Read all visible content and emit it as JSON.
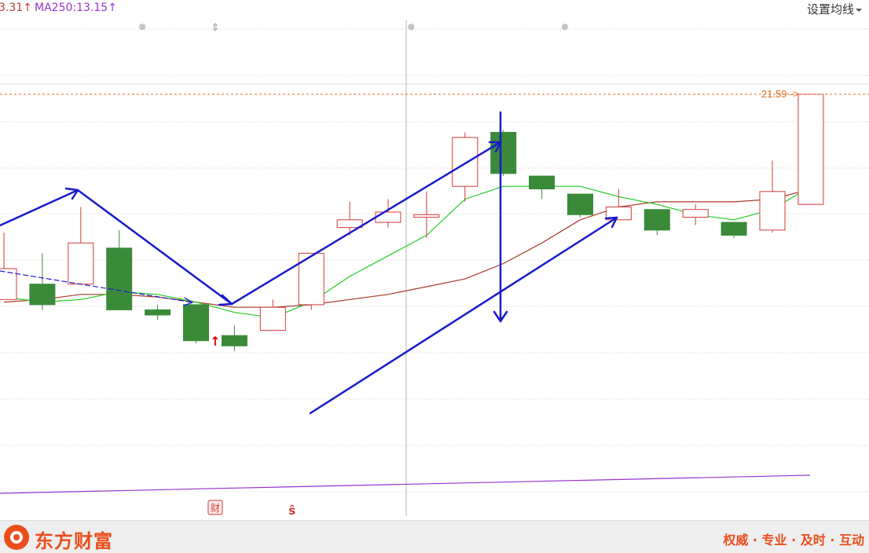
{
  "legend": {
    "ma_prev_text": "3.31",
    "ma250_label": "MA250:13.15",
    "arrow_glyph": "↑",
    "ma_prev_color": "#b0403a",
    "ma250_color": "#9933cc"
  },
  "header": {
    "settings_label": "设置均线",
    "settings_icon": "caret-down-icon"
  },
  "price_label": {
    "value": "21.59",
    "arrow": "->",
    "color": "#e07020"
  },
  "markers": {
    "star_glyph": "✵",
    "double_glyph": "⇕",
    "up_arrow_glyph": "↑",
    "fin_badge": "财",
    "s_badge": "S",
    "s_glyph": "ŝ"
  },
  "footer": {
    "brand": "东方财富",
    "slogan": "权威 · 专业 · 及时 · 互动",
    "brand_color": "#e94e1b"
  },
  "chart_data": {
    "type": "candlestick",
    "y_axis_visible": false,
    "y_scale_note": "price levels are read from the single printed reference price 21.59",
    "reference_price": 21.59,
    "candles": [
      {
        "open": 17.6,
        "close": 18.2,
        "high": 18.9,
        "low": 17.6
      },
      {
        "open": 17.9,
        "close": 17.5,
        "high": 18.5,
        "low": 17.4
      },
      {
        "open": 17.9,
        "close": 18.7,
        "high": 19.4,
        "low": 17.9
      },
      {
        "open": 18.6,
        "close": 17.4,
        "high": 18.95,
        "low": 17.4
      },
      {
        "open": 17.4,
        "close": 17.3,
        "high": 17.5,
        "low": 17.2
      },
      {
        "open": 17.5,
        "close": 16.8,
        "high": 17.5,
        "low": 16.75
      },
      {
        "open": 16.9,
        "close": 16.7,
        "high": 17.1,
        "low": 16.6
      },
      {
        "open": 17.0,
        "close": 17.45,
        "high": 17.6,
        "low": 17.0
      },
      {
        "open": 17.5,
        "close": 18.5,
        "high": 18.5,
        "low": 17.4
      },
      {
        "open": 19.0,
        "close": 19.15,
        "high": 19.5,
        "low": 18.85
      },
      {
        "open": 19.1,
        "close": 19.3,
        "high": 19.55,
        "low": 19.0
      },
      {
        "open": 19.2,
        "close": 19.25,
        "high": 19.7,
        "low": 18.8
      },
      {
        "open": 19.8,
        "close": 20.75,
        "high": 20.85,
        "low": 19.5
      },
      {
        "open": 20.85,
        "close": 20.05,
        "high": 20.9,
        "low": 20.0
      },
      {
        "open": 20.0,
        "close": 19.75,
        "high": 20.0,
        "low": 19.55
      },
      {
        "open": 19.65,
        "close": 19.25,
        "high": 19.65,
        "low": 19.2
      },
      {
        "open": 19.15,
        "close": 19.4,
        "high": 19.75,
        "low": 19.15
      },
      {
        "open": 19.35,
        "close": 18.95,
        "high": 19.35,
        "low": 18.85
      },
      {
        "open": 19.2,
        "close": 19.35,
        "high": 19.45,
        "low": 19.05
      },
      {
        "open": 19.1,
        "close": 18.85,
        "high": 19.1,
        "low": 18.8
      },
      {
        "open": 18.95,
        "close": 19.7,
        "high": 20.3,
        "low": 18.9
      },
      {
        "open": 19.45,
        "close": 21.59,
        "high": 21.59,
        "low": 19.45
      }
    ],
    "ma_short": [
      17.65,
      17.55,
      17.6,
      17.75,
      17.7,
      17.55,
      17.35,
      17.25,
      17.55,
      18.05,
      18.45,
      18.85,
      19.55,
      19.8,
      19.8,
      19.8,
      19.6,
      19.45,
      19.25,
      19.15,
      19.35,
      19.8
    ],
    "ma_long": [
      17.55,
      17.6,
      17.7,
      17.7,
      17.65,
      17.55,
      17.45,
      17.45,
      17.5,
      17.6,
      17.7,
      17.85,
      18.0,
      18.3,
      18.7,
      19.15,
      19.4,
      19.5,
      19.5,
      19.5,
      19.55,
      19.75
    ],
    "ma250_line": {
      "start": 12.6,
      "end": 13.15
    },
    "colors": {
      "up": "#d03a3a",
      "down": "#3a8a3a",
      "ma_short": "#22cc22",
      "ma_long": "#a83a2a",
      "ma250": "#9933cc",
      "annotation": "#1a1acc"
    },
    "grid": true,
    "annotations": {
      "top_stars_at": [
        3.6,
        10.6,
        14.6
      ],
      "double_arrow_at": 5.5,
      "up_arrow_at": 5.5,
      "fin_badge_at": 5.5,
      "s_badge_at": 7.5
    }
  }
}
